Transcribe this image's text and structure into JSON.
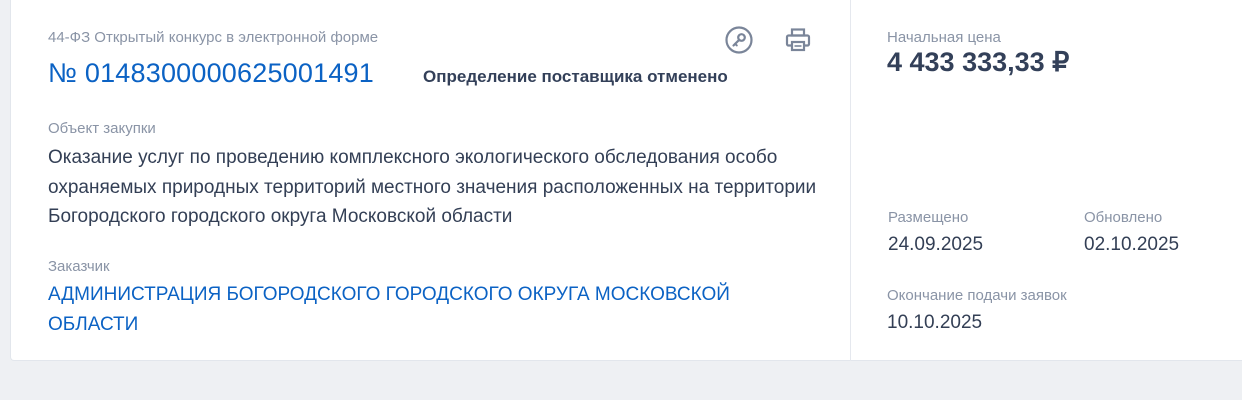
{
  "tender": {
    "law": "44-ФЗ Открытый конкурс в электронной форме",
    "number": "№ 0148300000625001491",
    "status": "Определение поставщика отменено",
    "object_label": "Объект закупки",
    "object_text": "Оказание услуг по проведению комплексного экологического обследования особо охраняемых природных территорий местного значения расположенных на территории Богородского городского округа Московской области",
    "customer_label": "Заказчик",
    "customer_name": "АДМИНИСТРАЦИЯ БОГОРОДСКОГО ГОРОДСКОГО ОКРУГА МОСКОВСКОЙ ОБЛАСТИ",
    "icons": [
      "key-icon",
      "print-icon"
    ]
  },
  "details": {
    "price_label": "Начальная цена",
    "price": "4 433 333,33 ₽",
    "posted_label": "Размещено",
    "posted_date": "24.09.2025",
    "updated_label": "Обновлено",
    "updated_date": "02.10.2025",
    "deadline_label": "Окончание подачи заявок",
    "deadline_date": "10.10.2025"
  },
  "colors": {
    "link": "#0b62c4",
    "label": "#8a94a6",
    "text": "#333f55",
    "icon": "#7a8599",
    "background": "#eef0f3"
  }
}
